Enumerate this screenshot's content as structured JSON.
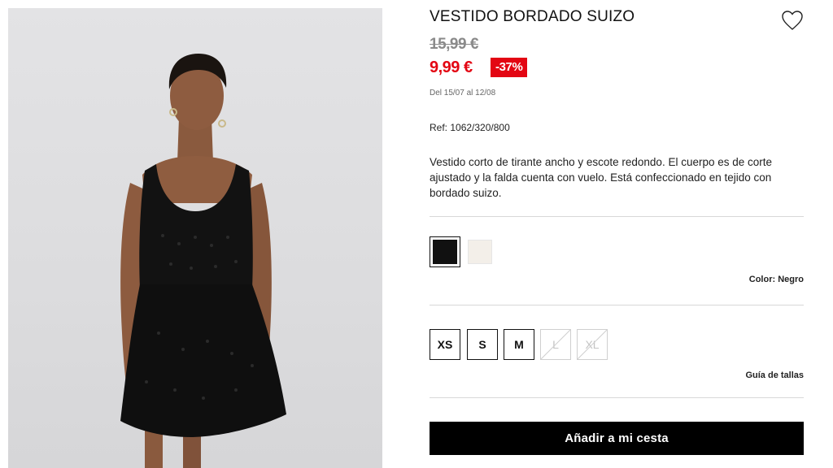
{
  "product": {
    "title": "VESTIDO BORDADO SUIZO",
    "old_price": "15,99 €",
    "new_price": "9,99 €",
    "discount": "-37%",
    "period": "Del 15/07 al 12/08",
    "reference": "Ref: 1062/320/800",
    "description": "Vestido corto de tirante ancho y escote redondo. El cuerpo es de corte ajustado y la falda cuenta con vuelo. Está confeccionado en tejido con bordado suizo."
  },
  "colors": {
    "options": [
      {
        "name": "Negro",
        "hex": "#111111",
        "selected": true
      },
      {
        "name": "Crudo",
        "hex": "#f3efe9",
        "selected": false
      }
    ],
    "label": "Color: Negro"
  },
  "sizes": {
    "options": [
      {
        "label": "XS",
        "available": true
      },
      {
        "label": "S",
        "available": true
      },
      {
        "label": "M",
        "available": true
      },
      {
        "label": "L",
        "available": false
      },
      {
        "label": "XL",
        "available": false
      }
    ],
    "guide_label": "Guía de tallas"
  },
  "cart": {
    "add_label": "Añadir a mi cesta"
  },
  "icons": {
    "favorite": "heart-icon"
  },
  "theme": {
    "sale_red": "#e30613",
    "primary_black": "#000000"
  }
}
